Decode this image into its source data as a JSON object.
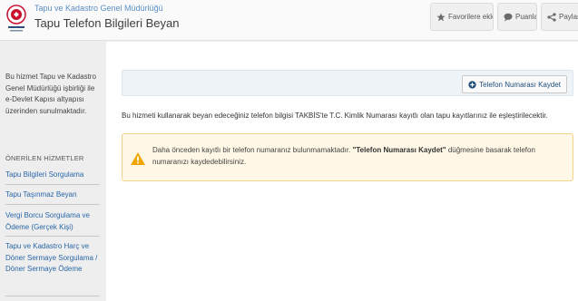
{
  "header": {
    "logo_text": "Tapu ve Kadastro",
    "org_name": "Tapu ve Kadastro Genel Müdürlüğü",
    "title": "Tapu Telefon Bilgileri Beyan",
    "buttons": {
      "favorite": "Favorilere ekle",
      "rate": "Puanla",
      "share": "Paylaş"
    }
  },
  "sidebar": {
    "description": "Bu hizmet Tapu ve Kadastro Genel Müdürlüğü işbirliği ile e-Devlet Kapısı altyapısı üzerinden sunulmaktadır.",
    "heading": "ÖNERİLEN HİZMETLER",
    "links": [
      "Tapu Bilgileri Sorgulama",
      "Tapu Taşınmaz Beyan",
      "Vergi Borcu Sorgulama ve Ödeme (Gerçek Kişi)",
      "Tapu ve Kadastro Harç ve Döner Sermaye Sorgulama / Döner Sermaye Ödeme"
    ]
  },
  "main": {
    "phone_button": "Telefon Numarası Kaydet",
    "intro": "Bu hizmeti kullanarak beyan edeceğiniz telefon bilgisi TAKBİS'te T.C. Kimlik Numarası kayıtlı olan tapu kayıtlarınız ile eşleştirilecektir.",
    "alert": {
      "text_before": "Daha önceden kayıtlı bir telefon numaranız bulunmamaktadır. ",
      "emphasis": "\"Telefon Numarası Kaydet\"",
      "text_after": " düğmesine basarak telefon numaranızı kaydedebilirsiniz."
    }
  },
  "colors": {
    "accent": "#2a67a8",
    "alert_bg": "#fff8e6",
    "alert_border": "#f4d289",
    "warning": "#f0a500"
  },
  "icons": {
    "favorite": "star-icon",
    "rate": "speech-bubble-icon",
    "share": "share-icon",
    "phone_button": "plus-circle-icon",
    "alert": "warning-triangle-icon"
  }
}
